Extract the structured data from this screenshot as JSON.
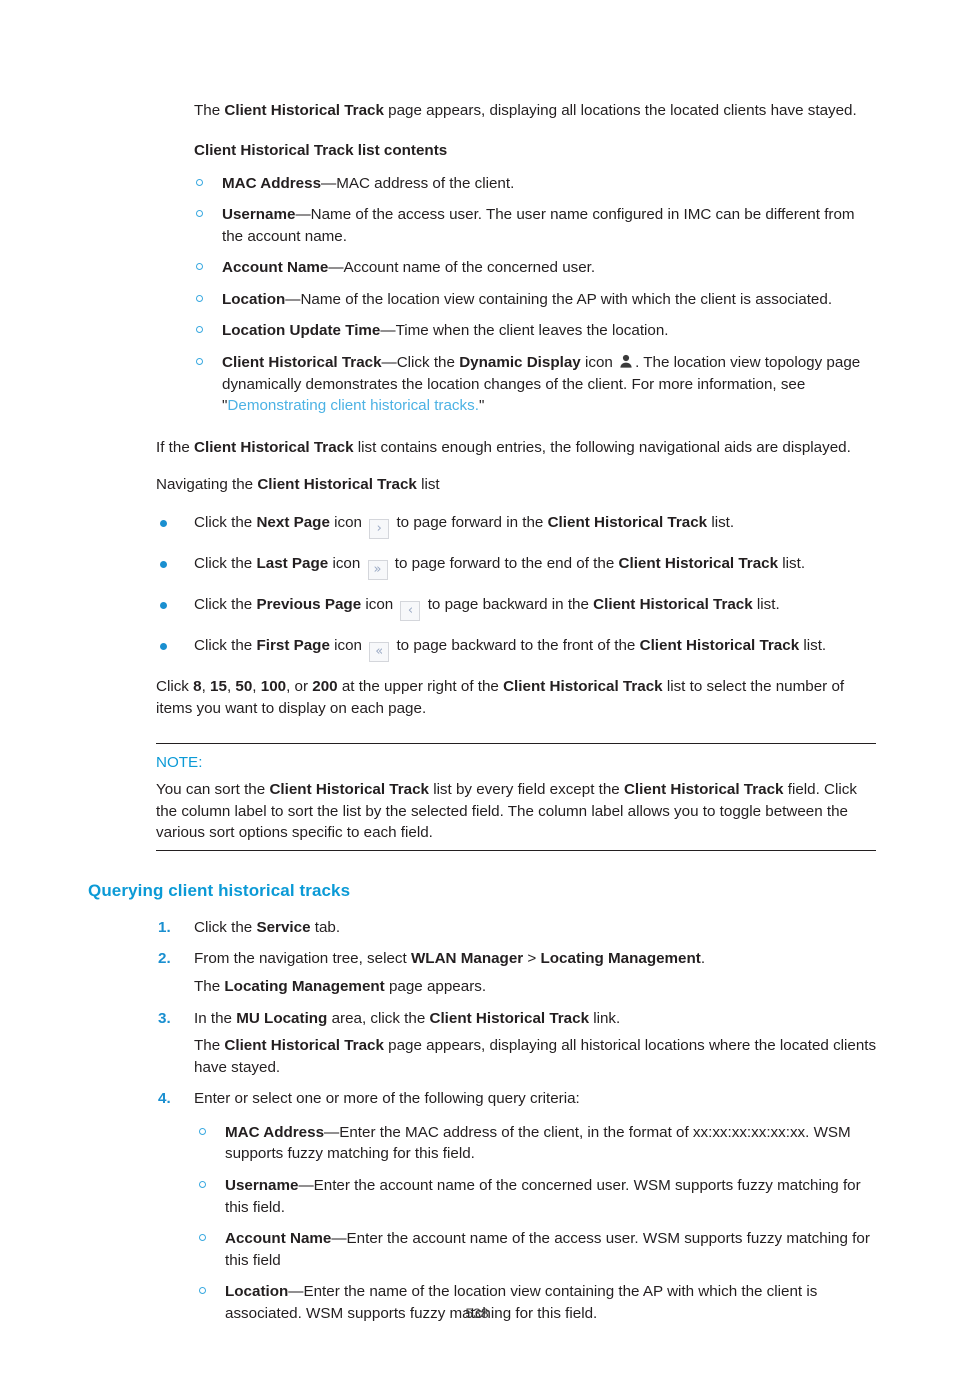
{
  "page": {
    "number": "538"
  },
  "intro": {
    "p1_a": "The ",
    "p1_b": "Client Historical Track",
    "p1_c": " page appears, displaying all locations the located clients have stayed."
  },
  "list_contents": {
    "heading": "Client Historical Track list contents",
    "items": [
      {
        "term": "MAC Address",
        "dash": "—",
        "desc": "MAC address of the client."
      },
      {
        "term": "Username",
        "dash": "—",
        "desc": "Name of the access user. The user name configured in IMC can be different from the account name."
      },
      {
        "term": "Account Name",
        "dash": "—",
        "desc": "Account name of the concerned user."
      },
      {
        "term": "Location",
        "dash": "—",
        "desc": "Name of the location view containing the AP with which the client is associated."
      },
      {
        "term": "Location Update Time",
        "dash": "—",
        "desc": "Time when the client leaves the location."
      }
    ],
    "track_item": {
      "term": "Client Historical Track",
      "dash": "—",
      "part1": "Click the ",
      "bold1": "Dynamic Display",
      "part2": " icon ",
      "icon": "user-silhouette-icon",
      "part3": ". The location view topology page dynamically demonstrates the location changes of the client. For more information, see \"",
      "link": "Demonstrating client historical tracks.",
      "part4": "\""
    }
  },
  "navigation": {
    "lead_a": "If the ",
    "lead_b": "Client Historical Track",
    "lead_c": " list contains enough entries, the following navigational aids are displayed.",
    "subhead_a": "Navigating the ",
    "subhead_b": "Client Historical Track",
    "subhead_c": " list",
    "bullets": [
      {
        "pre": "Click the ",
        "bold": "Next Page",
        "mid": " icon ",
        "icon_glyph": "›",
        "icon_name": "next-page-icon",
        "post_a": " to page forward in the ",
        "post_bold": "Client Historical Track",
        "post_b": " list."
      },
      {
        "pre": "Click the ",
        "bold": "Last Page",
        "mid": " icon ",
        "icon_glyph": "»",
        "icon_name": "last-page-icon",
        "post_a": " to page forward to the end of the ",
        "post_bold": "Client Historical Track",
        "post_b": " list."
      },
      {
        "pre": "Click the ",
        "bold": "Previous Page",
        "mid": " icon ",
        "icon_glyph": "‹",
        "icon_name": "previous-page-icon",
        "post_a": " to page backward in the ",
        "post_bold": "Client Historical Track",
        "post_b": " list."
      },
      {
        "pre": "Click the ",
        "bold": "First Page",
        "mid": " icon ",
        "icon_glyph": "«",
        "icon_name": "first-page-icon",
        "post_a": " to page backward to the front of the ",
        "post_bold": "Client Historical Track",
        "post_b": " list."
      }
    ],
    "pagesize": {
      "lead": "Click ",
      "opt1": "8",
      "sep1": ", ",
      "opt2": "15",
      "sep2": ", ",
      "opt3": "50",
      "sep3": ", ",
      "opt4": "100",
      "sep4": ", or ",
      "opt5": "200",
      "mid": " at the upper right of the ",
      "bold": "Client Historical Track",
      "tail": " list to select the number of items you want to display on each page."
    }
  },
  "note": {
    "label": "NOTE:",
    "b1": "You can sort the ",
    "bold1": "Client Historical Track",
    "b2": " list by every field except the ",
    "bold2": "Client Historical Track",
    "b3": " field. Click the column label to sort the list by the selected field. The column label allows you to toggle between the various sort options specific to each field."
  },
  "querying": {
    "heading": "Querying client historical tracks",
    "steps": [
      {
        "num": "1.",
        "pre": "Click the ",
        "bold": "Service",
        "post": " tab."
      },
      {
        "num": "2.",
        "pre": "From the navigation tree, select ",
        "bold": "WLAN Manager",
        "mid": " > ",
        "bold2": "Locating Management",
        "post": ".",
        "sub_pre": "The ",
        "sub_bold": "Locating Management",
        "sub_post": " page appears."
      },
      {
        "num": "3.",
        "pre": "In the ",
        "bold": "MU Locating",
        "mid": " area, click the ",
        "bold2": "Client Historical Track",
        "post": " link.",
        "sub_pre": "The ",
        "sub_bold": "Client Historical Track",
        "sub_post": " page appears, displaying all historical locations where the located clients have stayed."
      },
      {
        "num": "4.",
        "pre": "Enter or select one or more of the following query criteria:"
      }
    ],
    "criteria": [
      {
        "term": "MAC Address",
        "dash": "—",
        "desc": "Enter the MAC address of the client, in the format of xx:xx:xx:xx:xx:xx. WSM supports fuzzy matching for this field."
      },
      {
        "term": "Username",
        "dash": "—",
        "desc": "Enter the account name of the concerned user. WSM supports fuzzy matching for this field."
      },
      {
        "term": "Account Name",
        "dash": "—",
        "desc": "Enter the account name of the access user. WSM supports fuzzy matching for this field"
      },
      {
        "term": "Location",
        "dash": "—",
        "desc": "Enter the name of the location view containing the AP with which the client is associated. WSM supports fuzzy matching for this field."
      }
    ]
  },
  "colors": {
    "heading_blue": "#0b9ad6",
    "bullet_blue": "#1a8fd0",
    "link_blue": "#4cb2e4",
    "text": "#231f20"
  }
}
